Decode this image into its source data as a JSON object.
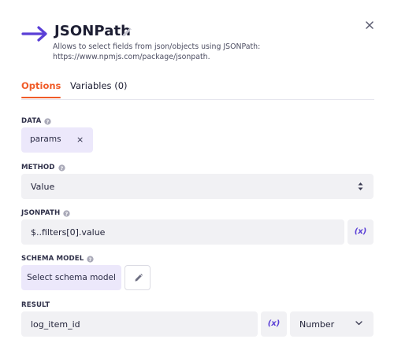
{
  "header": {
    "title": "JSONPath",
    "description_line1": "Allows to select fields from json/objects using JSONPath:",
    "description_line2": "https://www.npmjs.com/package/jsonpath."
  },
  "tabs": [
    {
      "label": "Options",
      "active": true
    },
    {
      "label": "Variables (0)",
      "active": false
    }
  ],
  "fields": {
    "data": {
      "label": "DATA",
      "chip_value": "params",
      "chip_remove": "×"
    },
    "method": {
      "label": "METHOD",
      "value": "Value"
    },
    "jsonpath": {
      "label": "JSONPATH",
      "value": "$..filters[0].value",
      "var_button": "(x)"
    },
    "schema_model": {
      "label": "SCHEMA MODEL",
      "button_label": "Select schema model"
    },
    "result": {
      "label": "RESULT",
      "value": "log_item_id",
      "var_button": "(x)",
      "type_value": "Number"
    }
  },
  "icons": {
    "arrow": "right-arrow-icon",
    "edit": "pencil-icon",
    "close": "close-icon",
    "help": "help-circle-icon",
    "sort": "sort-icon",
    "dropdown": "chevron-down-icon"
  },
  "colors": {
    "accent": "#f05b28",
    "brand_purple": "#5a3fd6",
    "chip_bg": "#ece8fb",
    "field_bg": "#f1f1f4"
  }
}
